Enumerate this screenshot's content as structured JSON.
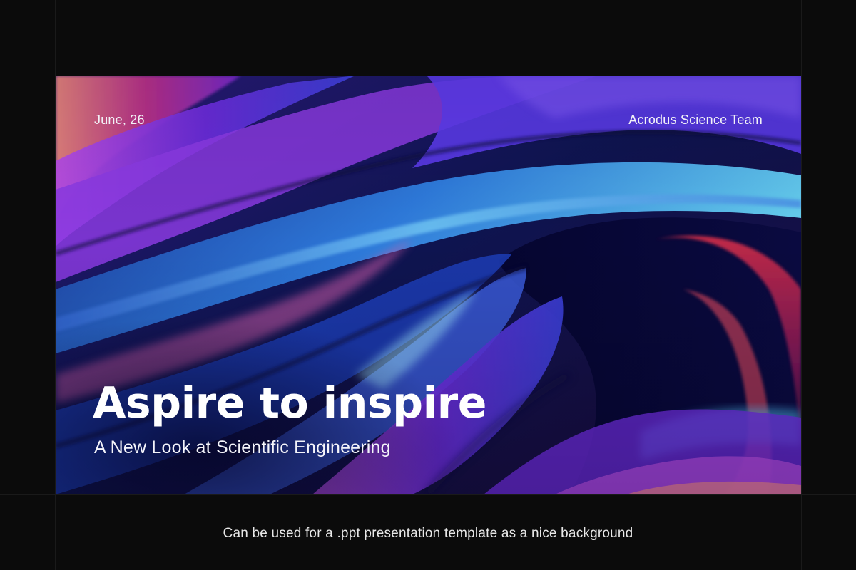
{
  "slide": {
    "date": "June, 26",
    "team": "Acrodus Science Team",
    "headline": "Aspire to inspire",
    "subtitle": "A New Look at Scientific Engineering"
  },
  "caption": "Can be used for a .ppt presentation template as a nice background",
  "colors": {
    "page_background": "#0b0b0b",
    "deep_navy": "#07072a",
    "violet": "#6a2bd9",
    "blue": "#2b5bd6",
    "cyan": "#5fd0f0",
    "magenta": "#c0308a",
    "coral": "#f08a7a",
    "text": "#ffffff"
  }
}
